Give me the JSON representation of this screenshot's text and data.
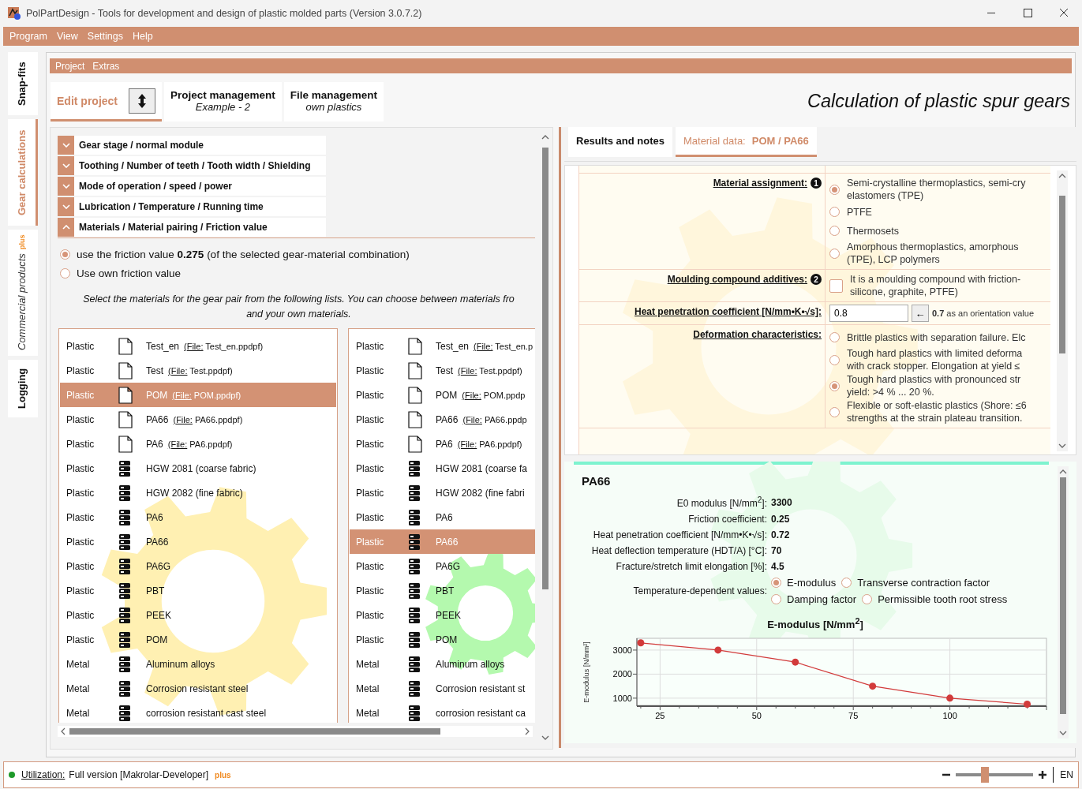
{
  "window": {
    "title": "PolPartDesign - Tools for development and design of plastic molded parts (Version 3.0.7.2)"
  },
  "menu": [
    "Program",
    "View",
    "Settings",
    "Help"
  ],
  "side_tabs": [
    {
      "label": "Snap-fits",
      "selected": false
    },
    {
      "label": "Gear calculations",
      "selected": true
    },
    {
      "label": "Commercial products",
      "badge": "plus",
      "selected": false
    },
    {
      "label": "Logging",
      "selected": false
    }
  ],
  "submenu": [
    "Project",
    "Extras"
  ],
  "project_tabs": [
    {
      "title": "Edit project",
      "selected": true
    },
    {
      "title": "Project management",
      "subtitle": "Example - 2",
      "selected": false
    },
    {
      "title": "File management",
      "subtitle": "own plastics",
      "selected": false
    }
  ],
  "page_title": "Calculation of plastic spur gears",
  "sections": [
    {
      "title": "Gear stage / normal module",
      "expanded": false
    },
    {
      "title": "Toothing / Number of teeth / Tooth width / Shielding",
      "expanded": false
    },
    {
      "title": "Mode of operation / speed / power",
      "expanded": false
    },
    {
      "title": "Lubrication / Temperature / Running time",
      "expanded": false
    },
    {
      "title": "Materials / Material pairing / Friction value",
      "expanded": true
    }
  ],
  "friction_options": [
    {
      "label": "use the friction value **0.275** (of the selected gear-material combination)",
      "selected": true
    },
    {
      "label": "Use own friction value",
      "selected": false
    }
  ],
  "instruction": [
    "Select the materials for the gear pair from the following lists. You can choose between materials fro",
    "and your own materials."
  ],
  "material_lists": [
    {
      "rows": [
        {
          "category": "Plastic",
          "kind": "file",
          "name": "Test_en",
          "file_label": "(File:",
          "file_name": "Test_en.ppdpf)",
          "selected": false
        },
        {
          "category": "Plastic",
          "kind": "file",
          "name": "Test",
          "file_label": "(File:",
          "file_name": "Test.ppdpf)",
          "selected": false
        },
        {
          "category": "Plastic",
          "kind": "file",
          "name": "POM",
          "file_label": "(File:",
          "file_name": "POM.ppdpf)",
          "selected": true
        },
        {
          "category": "Plastic",
          "kind": "file",
          "name": "PA66",
          "file_label": "(File:",
          "file_name": "PA66.ppdpf)",
          "selected": false
        },
        {
          "category": "Plastic",
          "kind": "file",
          "name": "PA6",
          "file_label": "(File:",
          "file_name": "PA6.ppdpf)",
          "selected": false
        },
        {
          "category": "Plastic",
          "kind": "db",
          "name": "HGW 2081 (coarse fabric)",
          "selected": false
        },
        {
          "category": "Plastic",
          "kind": "db",
          "name": "HGW 2082 (fine fabric)",
          "selected": false
        },
        {
          "category": "Plastic",
          "kind": "db",
          "name": "PA6",
          "selected": false
        },
        {
          "category": "Plastic",
          "kind": "db",
          "name": "PA66",
          "selected": false
        },
        {
          "category": "Plastic",
          "kind": "db",
          "name": "PA6G",
          "selected": false
        },
        {
          "category": "Plastic",
          "kind": "db",
          "name": "PBT",
          "selected": false
        },
        {
          "category": "Plastic",
          "kind": "db",
          "name": "PEEK",
          "selected": false
        },
        {
          "category": "Plastic",
          "kind": "db",
          "name": "POM",
          "selected": false
        },
        {
          "category": "Metal",
          "kind": "db",
          "name": "Aluminum alloys",
          "selected": false
        },
        {
          "category": "Metal",
          "kind": "db",
          "name": "Corrosion resistant steel",
          "selected": false
        },
        {
          "category": "Metal",
          "kind": "db",
          "name": "corrosion resistant cast steel",
          "selected": false
        }
      ]
    },
    {
      "rows": [
        {
          "category": "Plastic",
          "kind": "file",
          "name": "Test_en",
          "file_label": "(File:",
          "file_name": "Test_en.p",
          "selected": false
        },
        {
          "category": "Plastic",
          "kind": "file",
          "name": "Test",
          "file_label": "(File:",
          "file_name": "Test.ppdpf)",
          "selected": false
        },
        {
          "category": "Plastic",
          "kind": "file",
          "name": "POM",
          "file_label": "(File:",
          "file_name": "POM.ppdp",
          "selected": false
        },
        {
          "category": "Plastic",
          "kind": "file",
          "name": "PA66",
          "file_label": "(File:",
          "file_name": "PA66.ppdp",
          "selected": false
        },
        {
          "category": "Plastic",
          "kind": "file",
          "name": "PA6",
          "file_label": "(File:",
          "file_name": "PA6.ppdpf)",
          "selected": false
        },
        {
          "category": "Plastic",
          "kind": "db",
          "name": "HGW 2081 (coarse fa",
          "selected": false
        },
        {
          "category": "Plastic",
          "kind": "db",
          "name": "HGW 2082 (fine fabri",
          "selected": false
        },
        {
          "category": "Plastic",
          "kind": "db",
          "name": "PA6",
          "selected": false
        },
        {
          "category": "Plastic",
          "kind": "db",
          "name": "PA66",
          "selected": true
        },
        {
          "category": "Plastic",
          "kind": "db",
          "name": "PA6G",
          "selected": false
        },
        {
          "category": "Plastic",
          "kind": "db",
          "name": "PBT",
          "selected": false
        },
        {
          "category": "Plastic",
          "kind": "db",
          "name": "PEEK",
          "selected": false
        },
        {
          "category": "Plastic",
          "kind": "db",
          "name": "POM",
          "selected": false
        },
        {
          "category": "Metal",
          "kind": "db",
          "name": "Aluminum alloys",
          "selected": false
        },
        {
          "category": "Metal",
          "kind": "db",
          "name": "Corrosion resistant st",
          "selected": false
        },
        {
          "category": "Metal",
          "kind": "db",
          "name": "corrosion resistant ca",
          "selected": false
        }
      ]
    }
  ],
  "right_tabs": [
    {
      "label": "Results and notes",
      "selected": false
    },
    {
      "label": "Material data:",
      "value": "POM / PA66",
      "selected": true
    }
  ],
  "form": [
    {
      "label": "Material assignment:",
      "badge": "1",
      "kind": "radios",
      "options": [
        {
          "lines": [
            "Semi-crystalline thermoplastics, semi-cry",
            "elastomers (TPE)"
          ],
          "selected": true
        },
        {
          "lines": [
            "PTFE"
          ],
          "selected": false
        },
        {
          "lines": [
            "Thermosets"
          ],
          "selected": false
        },
        {
          "lines": [
            "Amorphous thermoplastics, amorphous",
            "(TPE), LCP polymers"
          ],
          "selected": false
        }
      ]
    },
    {
      "label": "Moulding compound additives:",
      "badge": "2",
      "kind": "checkbox",
      "checked": false,
      "lines": [
        "It is a moulding compound with friction-",
        "silicone, graphite, PTFE)"
      ]
    },
    {
      "label": "Heat penetration coefficient [N/mm•K•√s]:",
      "kind": "input",
      "value": "0.8",
      "button": "←",
      "hint": "**0.7** as an orientation value"
    },
    {
      "label": "Deformation characteristics:",
      "kind": "radios",
      "options": [
        {
          "lines": [
            "Brittle plastics with separation failure. Elc"
          ],
          "selected": false
        },
        {
          "lines": [
            "Tough hard plastics with limited deforma",
            "with crack stopper. Elongation at yield ≤"
          ],
          "selected": false
        },
        {
          "lines": [
            "Tough hard plastics with pronounced str",
            "yield: >4 % ... 20 %."
          ],
          "selected": true
        },
        {
          "lines": [
            "Flexible or soft-elastic plastics (Shore: ≤6",
            "strengths at the strain plateau transition."
          ],
          "selected": false
        }
      ]
    }
  ],
  "material": {
    "name": "PA66",
    "properties": [
      {
        "label": "E0 modulus [N/mm$^{2}$]:",
        "value": "3300"
      },
      {
        "label": "Friction coefficient:",
        "value": "0.25"
      },
      {
        "label": "Heat penetration coefficient [N/mm•K•√s]:",
        "value": "0.72"
      },
      {
        "label": "Heat deflection temperature (HDT/A) [°C]:",
        "value": "70"
      },
      {
        "label": "Fracture/stretch limit elongation [%]:",
        "value": "4.5"
      }
    ],
    "temperature_values": {
      "label": "Temperature-dependent values:",
      "options": [
        {
          "label": "E-modulus",
          "selected": true
        },
        {
          "label": "Transverse contraction factor",
          "selected": false
        },
        {
          "label": "Damping factor",
          "selected": false
        },
        {
          "label": "Permissible tooth root stress",
          "selected": false
        }
      ]
    },
    "chart_data": {
      "type": "line",
      "title": "E-modulus [N/mm$^{2}$]",
      "ylabel": "E-modulus [N/mm²]",
      "x": [
        20,
        40,
        60,
        80,
        100,
        120
      ],
      "series": [
        {
          "color": "#d23b3b",
          "marker": "circle",
          "values": [
            3300,
            3000,
            2500,
            1500,
            1000,
            750
          ]
        }
      ],
      "grid": true,
      "xlim": [
        19,
        125
      ],
      "ylim": [
        700,
        3490
      ],
      "xticks": [
        25,
        50,
        75,
        100
      ],
      "yticks": [
        1000,
        2000,
        3000
      ]
    }
  },
  "status_bar": {
    "link": "Utilization:",
    "text": "Full version [Makrolar-Developer]",
    "badge": "plus",
    "zoom": {
      "level": 0.37
    },
    "language": "EN"
  }
}
